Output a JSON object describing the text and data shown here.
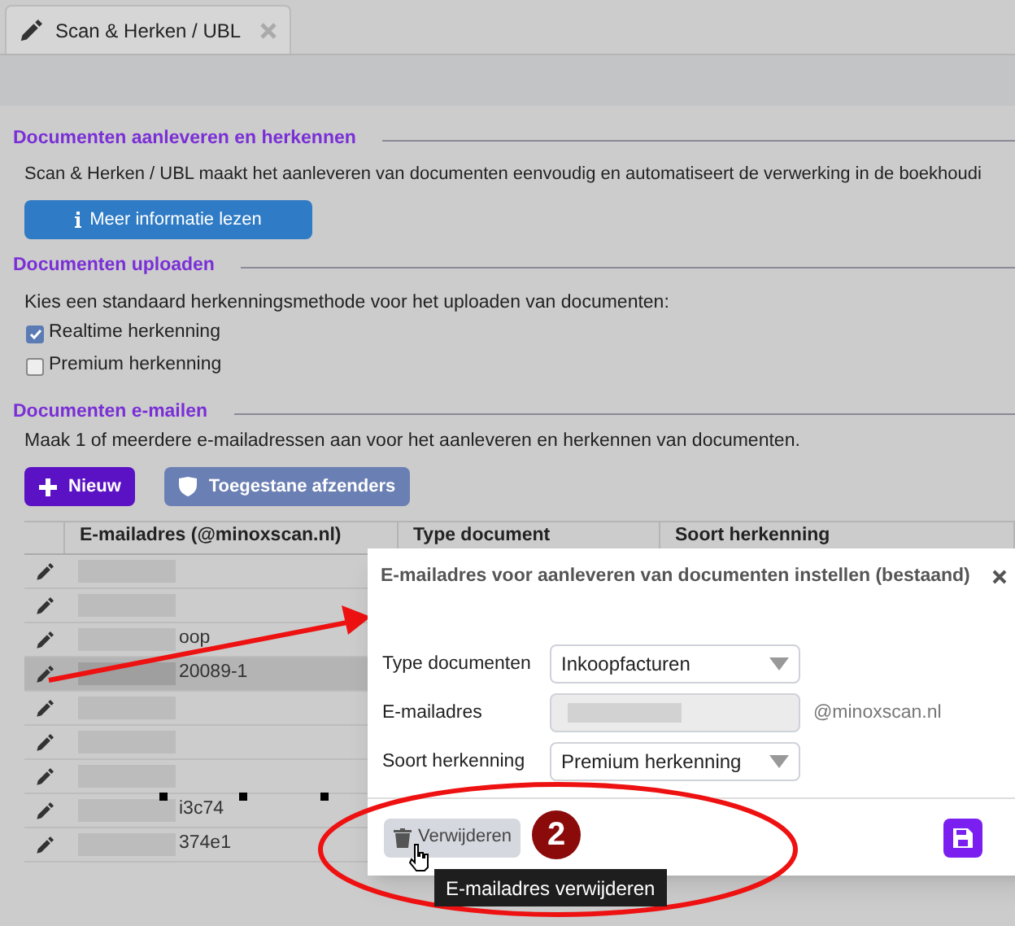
{
  "tab": {
    "title": "Scan & Herken / UBL"
  },
  "intro": {
    "heading": "Documenten aanleveren en herkennen",
    "text": "Scan & Herken / UBL maakt het aanleveren van documenten eenvoudig en automatiseert de verwerking in de boekhoudi",
    "button": "Meer informatie lezen"
  },
  "upload": {
    "heading": "Documenten uploaden",
    "text": "Kies een standaard herkenningsmethode voor het uploaden van documenten:",
    "options": [
      {
        "label": "Realtime herkenning",
        "checked": true
      },
      {
        "label": "Premium herkenning",
        "checked": false
      }
    ]
  },
  "email": {
    "heading": "Documenten e-mailen",
    "text": "Maak 1 of meerdere e-mailadressen aan voor het aanleveren en herkennen van documenten.",
    "buttons": [
      {
        "label": "Nieuw",
        "kind": "primary"
      },
      {
        "label": "Toegestane afzenders",
        "kind": "secondary"
      }
    ],
    "table": {
      "columns": [
        "E-mailadres (@minoxscan.nl)",
        "Type document",
        "Soort herkenning"
      ],
      "rows": [
        {
          "selected": false
        },
        {
          "selected": false
        },
        {
          "selected": false,
          "email": "oop"
        },
        {
          "selected": true,
          "email": "20089-1"
        },
        {
          "selected": false
        },
        {
          "selected": false
        },
        {
          "selected": false
        },
        {
          "selected": false,
          "email": "i3c74"
        },
        {
          "selected": false,
          "email": "374e1"
        }
      ]
    }
  },
  "dialog": {
    "title": "E-mailadres voor aanleveren van documenten instellen (bestaand)",
    "fields": [
      {
        "label": "Type documenten",
        "kind": "select",
        "value": "Inkoopfacturen"
      },
      {
        "label": "E-mailadres",
        "kind": "input",
        "suffix": "@minoxscan.nl"
      },
      {
        "label": "Soort herkenning",
        "kind": "select",
        "value": "Premium herkenning"
      }
    ],
    "delete_button": "Verwijderen",
    "tooltip": "E-mailadres verwijderen"
  },
  "annotation": {
    "number": "2"
  }
}
